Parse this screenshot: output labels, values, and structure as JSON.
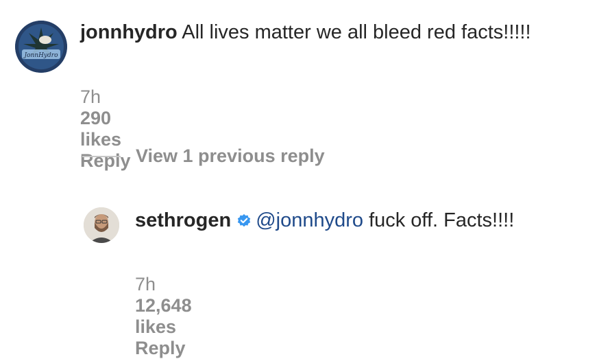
{
  "comments": [
    {
      "username": "jonnhydro",
      "text": "All lives matter we all bleed red facts!!!!!",
      "time": "7h",
      "likes": "290 likes",
      "reply_label": "Reply",
      "avatar_icon": "jonnhydro-avatar",
      "avatar_logo_text": "JonnHydro"
    },
    {
      "username": "sethrogen",
      "verified_icon": "verified-badge-icon",
      "mention": "@jonnhydro",
      "text": "fuck off. Facts!!!!",
      "time": "7h",
      "likes": "12,648 likes",
      "reply_label": "Reply",
      "avatar_icon": "sethrogen-avatar"
    }
  ],
  "view_replies": {
    "label": "View 1 previous reply"
  },
  "colors": {
    "text": "#262626",
    "muted": "#8e8e8e",
    "verified": "#3897f0",
    "mention": "#1f4a8a"
  }
}
